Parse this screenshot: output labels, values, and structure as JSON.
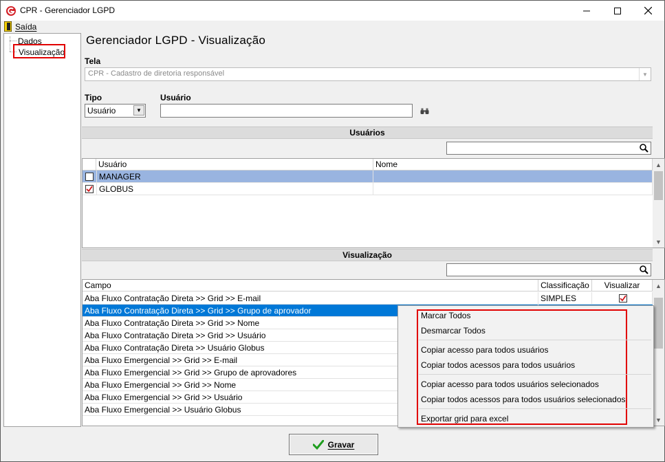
{
  "window": {
    "title": "CPR - Gerenciador LGPD"
  },
  "menu": {
    "saida_label": "Saída"
  },
  "tree": {
    "items": [
      {
        "label": "Dados"
      },
      {
        "label": "Visualização"
      }
    ]
  },
  "page": {
    "title": "Gerenciador LGPD - Visualização"
  },
  "form": {
    "tela_label": "Tela",
    "tela_value": "CPR - Cadastro de diretoria responsável",
    "tipo_label": "Tipo",
    "tipo_value": "Usuário",
    "usuario_label": "Usuário",
    "usuario_value": ""
  },
  "usuarios_section": {
    "title": "Usuários",
    "search_value": "",
    "columns": [
      "Usuário",
      "Nome"
    ],
    "rows": [
      {
        "checked": false,
        "usuario": "MANAGER",
        "nome": ""
      },
      {
        "checked": true,
        "usuario": "GLOBUS",
        "nome": ""
      }
    ]
  },
  "visualizacao_section": {
    "title": "Visualização",
    "search_value": "",
    "columns": [
      "Campo",
      "Classificação",
      "Visualizar"
    ],
    "rows": [
      {
        "campo": "Aba Fluxo Contratação Direta >> Grid >> E-mail",
        "classificacao": "SIMPLES",
        "visualizar": true
      },
      {
        "campo": "Aba Fluxo Contratação Direta >> Grid >> Grupo de aprovador",
        "classificacao": "",
        "visualizar": false
      },
      {
        "campo": "Aba Fluxo Contratação Direta >> Grid >> Nome",
        "classificacao": "",
        "visualizar": false
      },
      {
        "campo": "Aba Fluxo Contratação Direta >> Grid >> Usuário",
        "classificacao": "",
        "visualizar": false
      },
      {
        "campo": "Aba Fluxo Contratação Direta >> Usuário Globus",
        "classificacao": "",
        "visualizar": false
      },
      {
        "campo": "Aba Fluxo Emergencial >> Grid >> E-mail",
        "classificacao": "",
        "visualizar": false
      },
      {
        "campo": "Aba Fluxo Emergencial >> Grid >> Grupo de aprovadores",
        "classificacao": "",
        "visualizar": false
      },
      {
        "campo": "Aba Fluxo Emergencial >> Grid >> Nome",
        "classificacao": "",
        "visualizar": false
      },
      {
        "campo": "Aba Fluxo Emergencial >> Grid >> Usuário",
        "classificacao": "",
        "visualizar": false
      },
      {
        "campo": "Aba Fluxo Emergencial >> Usuário Globus",
        "classificacao": "",
        "visualizar": false
      }
    ]
  },
  "context_menu": {
    "items": [
      "Marcar Todos",
      "Desmarcar Todos",
      "Copiar acesso para todos usuários",
      "Copiar todos acessos para todos usuários",
      "Copiar acesso para todos usuários selecionados",
      "Copiar todos acessos para todos usuários selecionados",
      "Exportar grid para excel"
    ]
  },
  "buttons": {
    "gravar_label": "Gravar"
  },
  "colors": {
    "selection": "#0078d7",
    "row_selected_light": "#99b4e0",
    "highlight_border": "#e10000",
    "check_red": "#d0161a",
    "app_icon": "#d32027"
  }
}
